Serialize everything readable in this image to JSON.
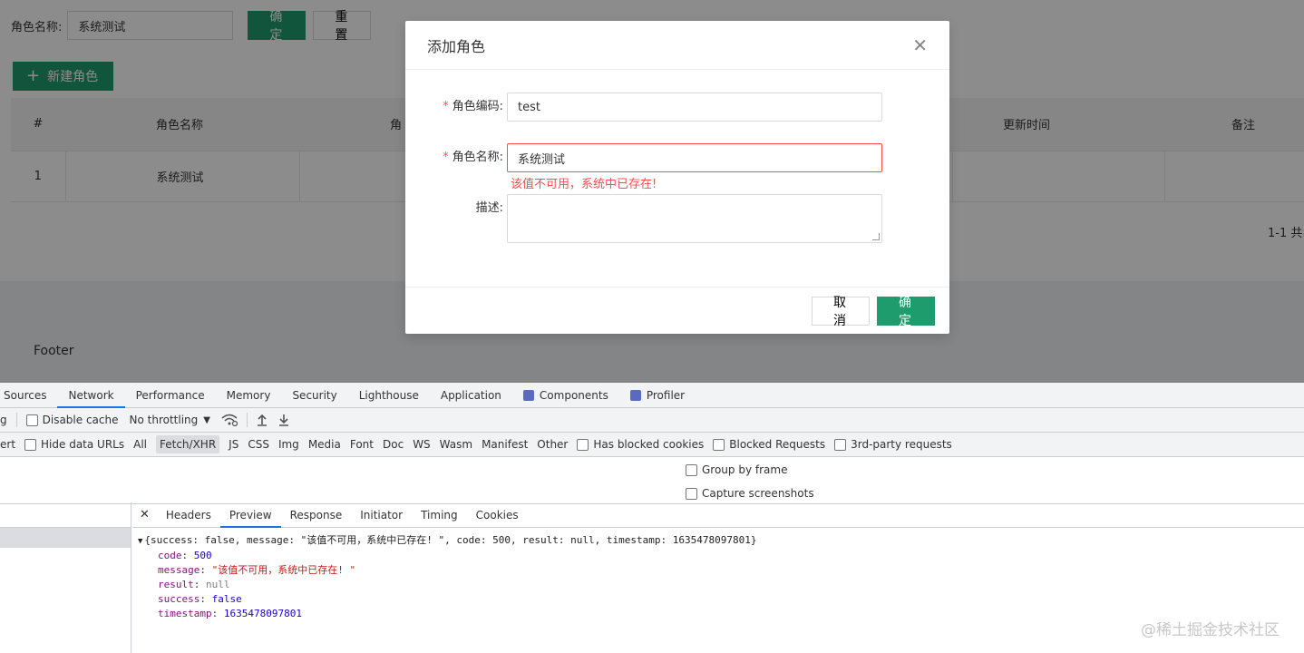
{
  "search": {
    "label": "角色名称:",
    "value": "系统测试",
    "confirm_label": "确 定",
    "reset_label": "重 置"
  },
  "toolbar": {
    "new_role_label": "新建角色"
  },
  "table": {
    "headers": [
      "#",
      "角色名称",
      "角",
      "更新时间",
      "备注"
    ],
    "rows": [
      {
        "index": "1",
        "name": "系统测试"
      }
    ],
    "pagination": "1-1 共"
  },
  "footer": {
    "text": "Footer"
  },
  "modal": {
    "title": "添加角色",
    "fields": {
      "code": {
        "label": "角色编码:",
        "value": "test",
        "required": "*"
      },
      "name": {
        "label": "角色名称:",
        "value": "系统测试",
        "required": "*",
        "error": "该值不可用，系统中已存在!"
      },
      "desc": {
        "label": "描述:",
        "value": ""
      }
    },
    "cancel_label": "取 消",
    "ok_label": "确 定"
  },
  "devtools": {
    "tabs": [
      "Sources",
      "Network",
      "Performance",
      "Memory",
      "Security",
      "Lighthouse",
      "Application",
      "Components",
      "Profiler"
    ],
    "active_tab": "Network",
    "toolbar": {
      "prefix": "g",
      "disable_cache": "Disable cache",
      "throttling": "No throttling"
    },
    "filter": {
      "prefix": "ert",
      "hide_data_urls": "Hide data URLs",
      "types": [
        "All",
        "Fetch/XHR",
        "JS",
        "CSS",
        "Img",
        "Media",
        "Font",
        "Doc",
        "WS",
        "Wasm",
        "Manifest",
        "Other"
      ],
      "active_type": "Fetch/XHR",
      "has_blocked_cookies": "Has blocked cookies",
      "blocked_requests": "Blocked Requests",
      "third_party": "3rd-party requests"
    },
    "options": {
      "group_by_frame": "Group by frame",
      "capture_screenshots": "Capture screenshots"
    },
    "detail_tabs": [
      "Headers",
      "Preview",
      "Response",
      "Initiator",
      "Timing",
      "Cookies"
    ],
    "active_detail_tab": "Preview",
    "preview": {
      "summary": "{success: false, message: \"该值不可用，系统中已存在! \", code: 500, result: null, timestamp: 1635478097801}",
      "code_key": "code",
      "code_val": "500",
      "message_key": "message",
      "message_val": "\"该值不可用，系统中已存在! \"",
      "result_key": "result",
      "result_val": "null",
      "success_key": "success",
      "success_val": "false",
      "timestamp_key": "timestamp",
      "timestamp_val": "1635478097801"
    }
  },
  "watermark": "@稀土掘金技术社区",
  "colors": {
    "primary": "#1f9c6e",
    "error": "#ff4d4f",
    "devtools_accent": "#1a73e8"
  }
}
